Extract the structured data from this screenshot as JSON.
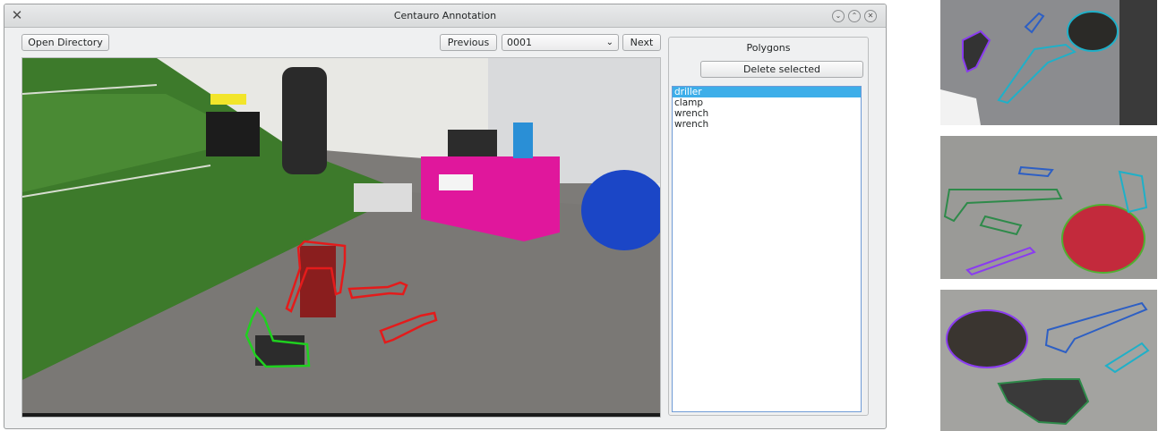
{
  "window": {
    "title": "Centauro Annotation",
    "controls": [
      "minimize-icon",
      "maximize-icon",
      "close-icon"
    ]
  },
  "toolbar": {
    "open_directory_label": "Open Directory",
    "previous_label": "Previous",
    "frame_value": "0001",
    "next_label": "Next"
  },
  "polygons_panel": {
    "title": "Polygons",
    "delete_label": "Delete selected",
    "items": [
      {
        "label": "driller",
        "selected": true
      },
      {
        "label": "clamp",
        "selected": false
      },
      {
        "label": "wrench",
        "selected": false
      },
      {
        "label": "wrench",
        "selected": false
      }
    ]
  },
  "annotation_colors": {
    "driller": "#1fd11f",
    "clamp": "#e41b1b",
    "wrench": "#e41b1b"
  },
  "accent": "#3daee9"
}
